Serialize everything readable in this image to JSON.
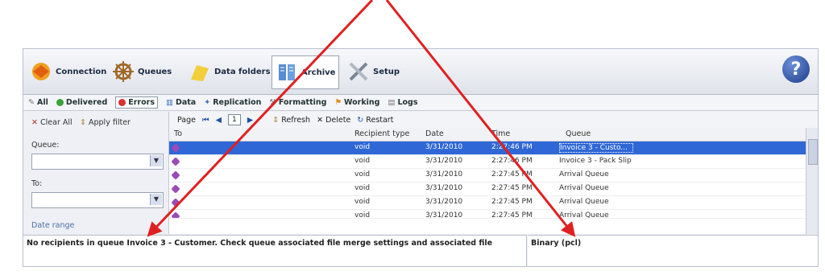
{
  "toolbar": {
    "items": [
      {
        "label": "Connection"
      },
      {
        "label": "Queues"
      },
      {
        "label": "Data folders"
      },
      {
        "label": "Archive"
      },
      {
        "label": "Setup"
      }
    ],
    "help_glyph": "?"
  },
  "filters": {
    "items": [
      "All",
      "Delivered",
      "Errors",
      "Data",
      "Replication",
      "Formatting",
      "Working",
      "Logs"
    ]
  },
  "sidebar": {
    "clear_all": "Clear All",
    "apply_filter": "Apply filter",
    "queue_label": "Queue:",
    "to_label": "To:",
    "date_range_label": "Date range"
  },
  "pager": {
    "page_label": "Page",
    "page_value": "1",
    "refresh": "Refresh",
    "delete": "Delete",
    "restart": "Restart"
  },
  "table": {
    "headers": [
      "To",
      "Recipient type",
      "Date",
      "Time",
      "Queue"
    ],
    "rows": [
      {
        "recipient_type": "void",
        "date": "3/31/2010",
        "time": "2:27:46 PM",
        "queue": "Invoice 3 - Custo...",
        "selected": true
      },
      {
        "recipient_type": "void",
        "date": "3/31/2010",
        "time": "2:27:46 PM",
        "queue": "Invoice 3 - Pack Slip",
        "selected": false
      },
      {
        "recipient_type": "void",
        "date": "3/31/2010",
        "time": "2:27:45 PM",
        "queue": "Arrival Queue",
        "selected": false
      },
      {
        "recipient_type": "void",
        "date": "3/31/2010",
        "time": "2:27:45 PM",
        "queue": "Arrival Queue",
        "selected": false
      },
      {
        "recipient_type": "void",
        "date": "3/31/2010",
        "time": "2:27:45 PM",
        "queue": "Arrival Queue",
        "selected": false
      },
      {
        "recipient_type": "void",
        "date": "3/31/2010",
        "time": "2:27:45 PM",
        "queue": "Arrival Queue",
        "selected": false
      }
    ]
  },
  "status": {
    "message": "No recipients in queue Invoice 3 - Customer. Check queue associated file merge settings and associated file",
    "format": "Binary (pcl)"
  },
  "colors": {
    "annotation_arrow": "#e02020",
    "selection": "#2f67d6"
  }
}
